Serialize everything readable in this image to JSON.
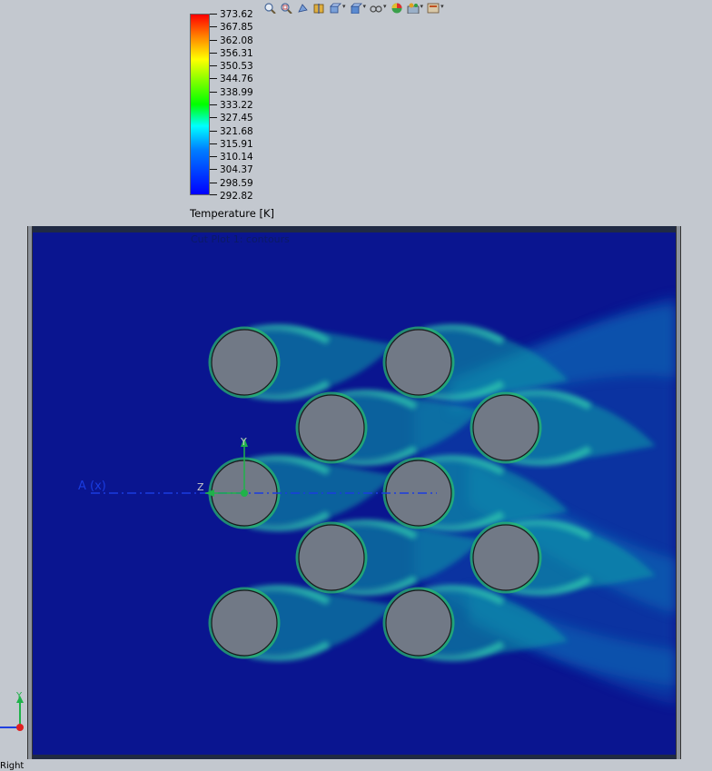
{
  "toolbar": {
    "items": [
      {
        "icon": "zoom-fit-icon",
        "dropdown": false
      },
      {
        "icon": "zoom-area-icon",
        "dropdown": false
      },
      {
        "icon": "previous-view-icon",
        "dropdown": false
      },
      {
        "icon": "section-view-icon",
        "dropdown": false
      },
      {
        "icon": "view-orientation-icon",
        "dropdown": true
      },
      {
        "icon": "display-style-icon",
        "dropdown": true
      },
      {
        "icon": "hide-show-items-icon",
        "dropdown": true
      },
      {
        "icon": "edit-appearance-icon",
        "dropdown": false
      },
      {
        "icon": "apply-scene-icon",
        "dropdown": true
      },
      {
        "icon": "view-settings-icon",
        "dropdown": true
      }
    ]
  },
  "legend": {
    "title": "Temperature [K]",
    "labels": [
      "373.62",
      "367.85",
      "362.08",
      "356.31",
      "350.53",
      "344.76",
      "338.99",
      "333.22",
      "327.45",
      "321.68",
      "315.91",
      "310.14",
      "304.37",
      "298.59",
      "292.82"
    ],
    "colors": {
      "max": "#ff0000",
      "mid": "#00ff00",
      "min": "#0000ff"
    }
  },
  "plot": {
    "cut_plot_label": "Cut Plot 1: contours",
    "background_color": "#0a1590",
    "cylinder_color": "#717986",
    "axis_label": "A (x)",
    "y_label": "Y",
    "z_label": "Z"
  },
  "triad": {
    "y_label": "Y"
  },
  "status": {
    "text": "Right"
  }
}
